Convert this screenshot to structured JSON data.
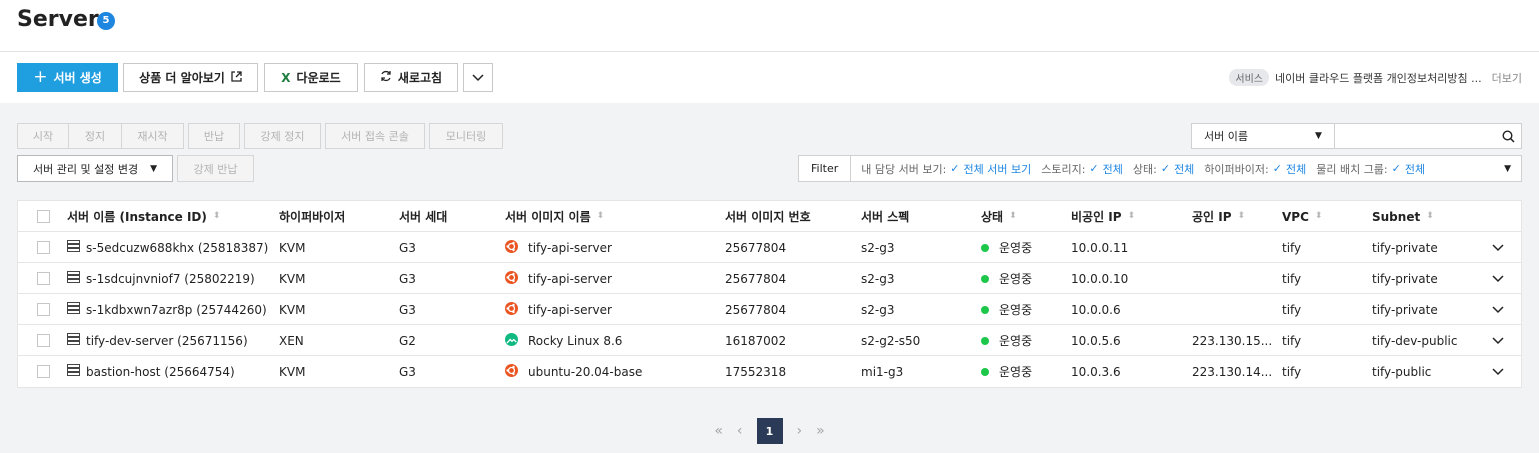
{
  "page": {
    "title": "Server",
    "count": "5"
  },
  "toolbar": {
    "create_label": "서버 생성",
    "learn_more_label": "상품 더 알아보기",
    "download_label": "다운로드",
    "refresh_label": "새로고침"
  },
  "notice": {
    "tag": "서비스",
    "text": "네이버 클라우드 플랫폼 개인정보처리방침 ...",
    "more": "더보기"
  },
  "actions": [
    "시작",
    "정지",
    "재시작",
    "반납",
    "강제 정지",
    "서버 접속 콘솔",
    "모니터링"
  ],
  "management": {
    "label": "서버 관리 및 설정 변경",
    "force_return": "강제 반납"
  },
  "search": {
    "select_value": "서버 이름",
    "placeholder": ""
  },
  "filter": {
    "label": "Filter",
    "items": [
      {
        "name": "내 담당 서버 보기:",
        "value": "전체 서버 보기"
      },
      {
        "name": "스토리지:",
        "value": "전체"
      },
      {
        "name": "상태:",
        "value": "전체"
      },
      {
        "name": "하이퍼바이저:",
        "value": "전체"
      },
      {
        "name": "물리 배치 그룹:",
        "value": "전체"
      }
    ]
  },
  "table": {
    "headers": {
      "name": "서버 이름 (Instance ID)",
      "hypervisor": "하이퍼바이저",
      "generation": "서버 세대",
      "image_name": "서버 이미지 이름",
      "image_no": "서버 이미지 번호",
      "spec": "서버 스펙",
      "status": "상태",
      "private_ip": "비공인 IP",
      "public_ip": "공인 IP",
      "vpc": "VPC",
      "subnet": "Subnet"
    },
    "rows": [
      {
        "name": "s-5edcuzw688khx (25818387)",
        "hypervisor": "KVM",
        "generation": "G3",
        "image_name": "tify-api-server",
        "image_icon": "ubuntu",
        "image_no": "25677804",
        "spec": "s2-g3",
        "status": "운영중",
        "private_ip": "10.0.0.11",
        "public_ip": "",
        "vpc": "tify",
        "subnet": "tify-private"
      },
      {
        "name": "s-1sdcujnvniof7 (25802219)",
        "hypervisor": "KVM",
        "generation": "G3",
        "image_name": "tify-api-server",
        "image_icon": "ubuntu",
        "image_no": "25677804",
        "spec": "s2-g3",
        "status": "운영중",
        "private_ip": "10.0.0.10",
        "public_ip": "",
        "vpc": "tify",
        "subnet": "tify-private"
      },
      {
        "name": "s-1kdbxwn7azr8p (25744260)",
        "hypervisor": "KVM",
        "generation": "G3",
        "image_name": "tify-api-server",
        "image_icon": "ubuntu",
        "image_no": "25677804",
        "spec": "s2-g3",
        "status": "운영중",
        "private_ip": "10.0.0.6",
        "public_ip": "",
        "vpc": "tify",
        "subnet": "tify-private"
      },
      {
        "name": "tify-dev-server (25671156)",
        "hypervisor": "XEN",
        "generation": "G2",
        "image_name": "Rocky Linux 8.6",
        "image_icon": "rocky",
        "image_no": "16187002",
        "spec": "s2-g2-s50",
        "status": "운영중",
        "private_ip": "10.0.5.6",
        "public_ip": "223.130.15...",
        "vpc": "tify",
        "subnet": "tify-dev-public"
      },
      {
        "name": "bastion-host (25664754)",
        "hypervisor": "KVM",
        "generation": "G3",
        "image_name": "ubuntu-20.04-base",
        "image_icon": "ubuntu",
        "image_no": "17552318",
        "spec": "mi1-g3",
        "status": "운영중",
        "private_ip": "10.0.3.6",
        "public_ip": "223.130.14...",
        "vpc": "tify",
        "subnet": "tify-public"
      }
    ]
  },
  "pagination": {
    "current": "1"
  },
  "colors": {
    "primary": "#1f9fe0",
    "accent": "#1f86e0",
    "status_running": "#1cc74a",
    "ubuntu": "#e95420",
    "rocky": "#10b981",
    "excel": "#1d7d3f"
  }
}
